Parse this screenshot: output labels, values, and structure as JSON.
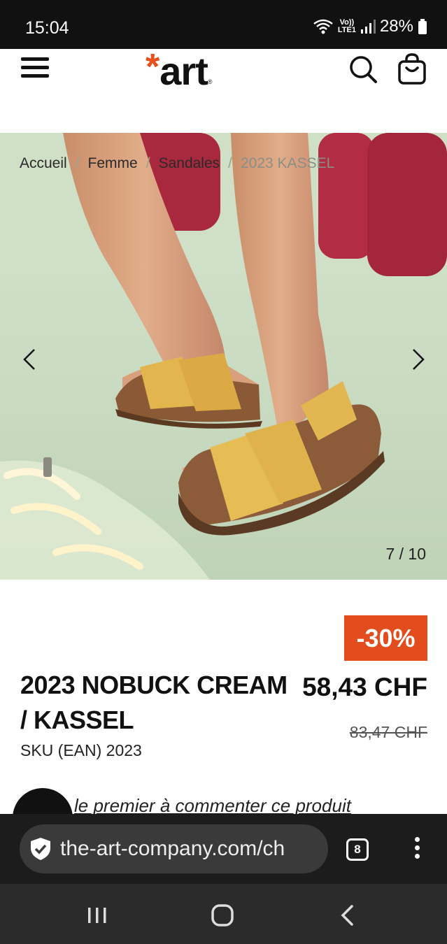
{
  "status_bar": {
    "time": "15:04",
    "network_top": "Vo))",
    "network_bottom": "LTE1",
    "battery": "28%"
  },
  "header": {
    "logo_text": "art",
    "logo_reg": "®"
  },
  "breadcrumb": {
    "items": [
      "Accueil",
      "Femme",
      "Sandales"
    ],
    "separator": "/",
    "current": "2023 KASSEL"
  },
  "gallery": {
    "counter": "7 / 10"
  },
  "product": {
    "discount": "-30%",
    "title": "2023 NOBUCK CREAM / KASSEL",
    "price": "58,43 CHF",
    "old_price": "83,47 CHF",
    "sku": "SKU (EAN) 2023"
  },
  "reviews": {
    "prompt": "le premier à commenter ce produit"
  },
  "browser": {
    "url": "the-art-company.com/ch",
    "tab_count": "8"
  },
  "colors": {
    "accent": "#e34d1d",
    "logo_star": "#e8501c"
  }
}
